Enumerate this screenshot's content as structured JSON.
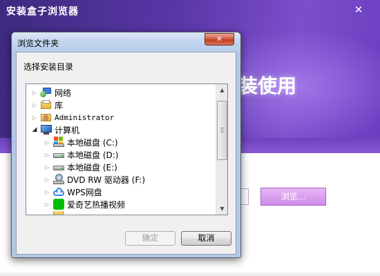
{
  "installer": {
    "title": "安装盒子浏览器",
    "close_glyph": "✕",
    "slogan": "装使用",
    "browse_label": "浏览..."
  },
  "dialog": {
    "title": "浏览文件夹",
    "close_glyph": "✕",
    "prompt": "选择安装目录",
    "tree": [
      {
        "label": "网络",
        "icon": "network-icon",
        "arrow": "▷"
      },
      {
        "label": "库",
        "icon": "library-folder-icon",
        "arrow": "▷"
      },
      {
        "label": "Administrator",
        "icon": "user-folder-icon",
        "arrow": "▷"
      },
      {
        "label": "计算机",
        "icon": "computer-icon",
        "arrow": "◢"
      },
      {
        "label": "本地磁盘 (C:)",
        "icon": "windows-drive-icon",
        "arrow": "▷"
      },
      {
        "label": "本地磁盘 (D:)",
        "icon": "hard-drive-icon",
        "arrow": "▷"
      },
      {
        "label": "本地磁盘 (E:)",
        "icon": "hard-drive-icon",
        "arrow": "▷"
      },
      {
        "label": "DVD RW 驱动器 (F:)",
        "icon": "dvd-drive-icon",
        "arrow": "▷"
      },
      {
        "label": "WPS网盘",
        "icon": "cloud-drive-icon",
        "arrow": "▷"
      },
      {
        "label": "爱奇艺热播视频",
        "icon": "iqiyi-icon",
        "arrow": "▷"
      }
    ],
    "scroll_up_glyph": "▲",
    "scroll_down_glyph": "▼",
    "ok_label": "确定",
    "cancel_label": "取消"
  }
}
